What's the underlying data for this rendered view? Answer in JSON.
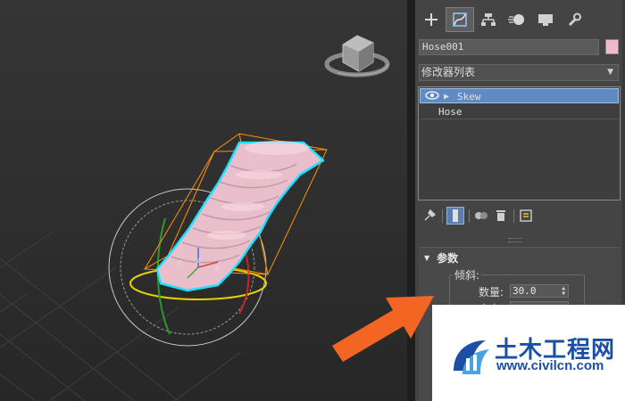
{
  "viewport": {
    "object_color": "#eec0d0",
    "selection_color": "#00e5ff",
    "gizmo_color": "#ff9000"
  },
  "command_panel": {
    "tabs": [
      {
        "name": "create",
        "icon": "plus-icon",
        "active": false
      },
      {
        "name": "modify",
        "icon": "modify-curve-icon",
        "active": true
      },
      {
        "name": "hierarchy",
        "icon": "hierarchy-icon",
        "active": false
      },
      {
        "name": "motion",
        "icon": "motion-icon",
        "active": false
      },
      {
        "name": "display",
        "icon": "display-monitor-icon",
        "active": false
      },
      {
        "name": "utilities",
        "icon": "wrench-icon",
        "active": false
      }
    ],
    "object_name": "Hose001",
    "object_color": "#f0b9cf",
    "modifier_list_label": "修改器列表",
    "modifier_stack": {
      "selected": "Skew",
      "base": "Hose"
    },
    "stack_tools": [
      "pin-stack-icon",
      "show-end-result-icon",
      "make-unique-icon",
      "remove-modifier-icon",
      "configure-sets-icon"
    ],
    "rollout": {
      "title": "参数",
      "group_label": "倾斜:",
      "amount_label": "数量:",
      "amount_value": "30.0",
      "direction_label": "方向:"
    }
  },
  "watermark": {
    "title": "土木工程网",
    "url": "www.civilcn.com"
  }
}
